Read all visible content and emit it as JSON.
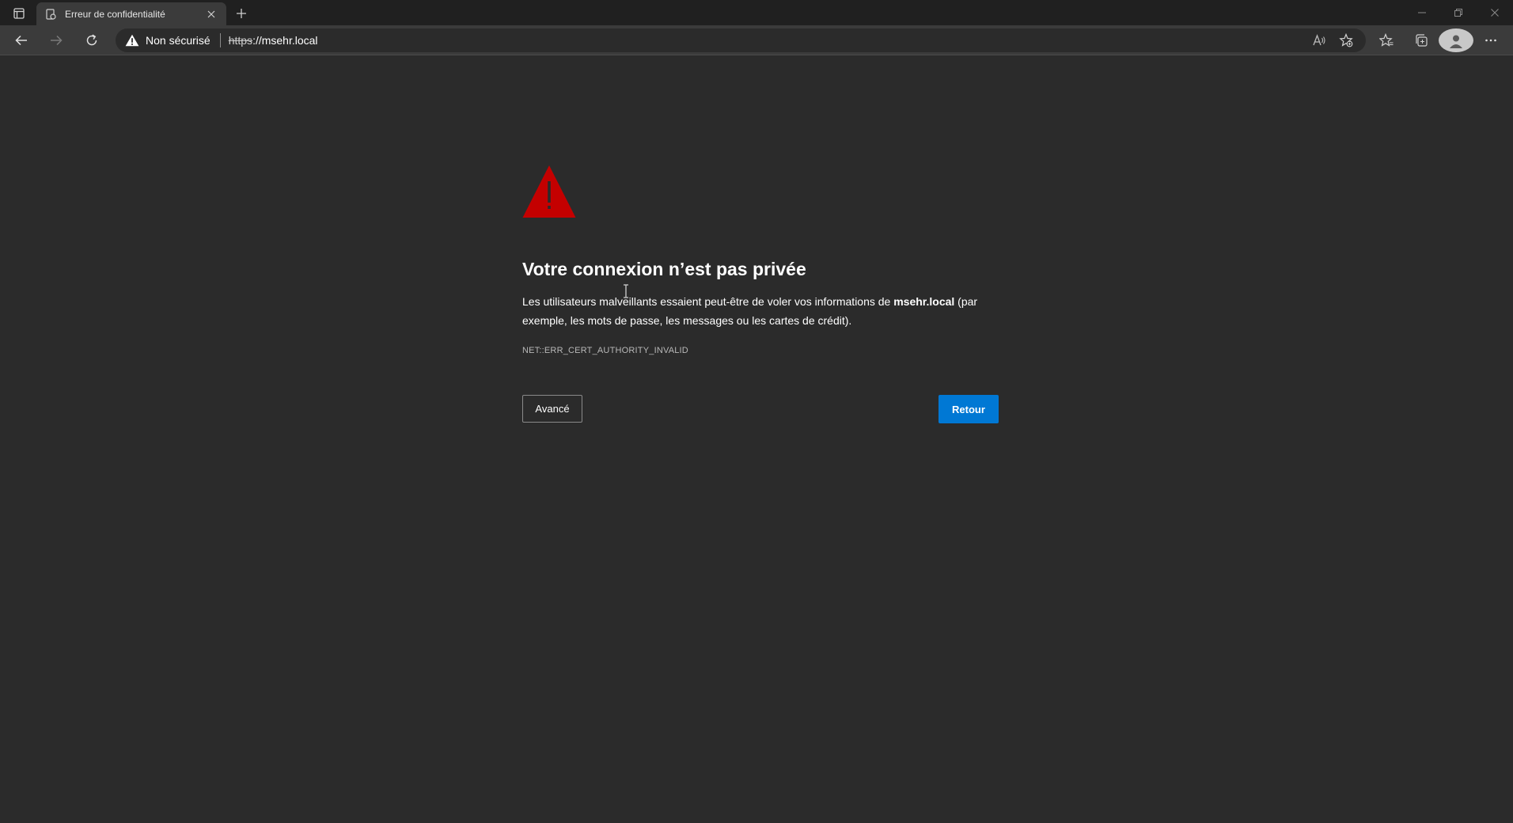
{
  "browser": {
    "tab": {
      "title": "Erreur de confidentialité",
      "favicon": "privacy-error-icon"
    },
    "window_controls": [
      "minimize-icon",
      "restore-icon",
      "close-icon"
    ]
  },
  "toolbar": {
    "security_status": "Non sécurisé",
    "url_scheme": "https",
    "url_rest": "://msehr.local",
    "icons": [
      "back-icon",
      "forward-icon",
      "refresh-icon",
      "read-aloud-icon",
      "add-favorite-icon",
      "favorites-icon",
      "collections-icon",
      "profile-icon",
      "more-icon"
    ]
  },
  "page": {
    "heading": "Votre connexion n’est pas privée",
    "message_before": "Les utilisateurs malveillants essaient peut-être de voler vos informations de ",
    "message_host": "msehr.local",
    "message_after": " (par exemple, les mots de passe, les messages ou les cartes de crédit).",
    "error_code": "NET::ERR_CERT_AUTHORITY_INVALID",
    "advanced_label": "Avancé",
    "back_label": "Retour"
  },
  "colors": {
    "background": "#2b2b2b",
    "warning_red": "#c40000",
    "primary_button": "#0078d4"
  }
}
